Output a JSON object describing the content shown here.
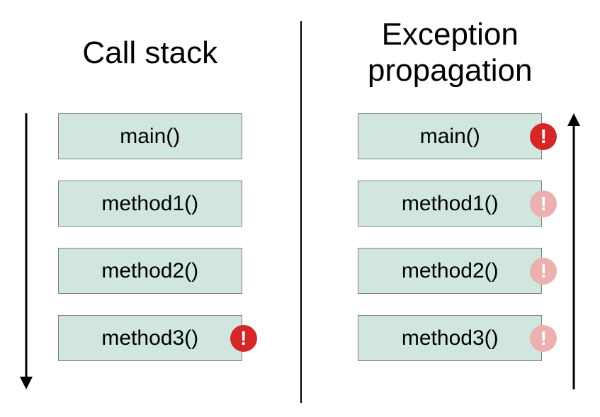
{
  "left": {
    "title": "Call stack",
    "frames": [
      {
        "label": "main()",
        "marker": null
      },
      {
        "label": "method1()",
        "marker": null
      },
      {
        "label": "method2()",
        "marker": null
      },
      {
        "label": "method3()",
        "marker": "solid"
      }
    ],
    "arrow_direction": "down"
  },
  "right": {
    "title": "Exception propagation",
    "frames": [
      {
        "label": "main()",
        "marker": "solid"
      },
      {
        "label": "method1()",
        "marker": "faded"
      },
      {
        "label": "method2()",
        "marker": "faded"
      },
      {
        "label": "method3()",
        "marker": "faded"
      }
    ],
    "arrow_direction": "up"
  },
  "colors": {
    "frame_bg": "#d0e6de",
    "marker_solid": "#d62728",
    "marker_faded": "#ecb0af"
  }
}
